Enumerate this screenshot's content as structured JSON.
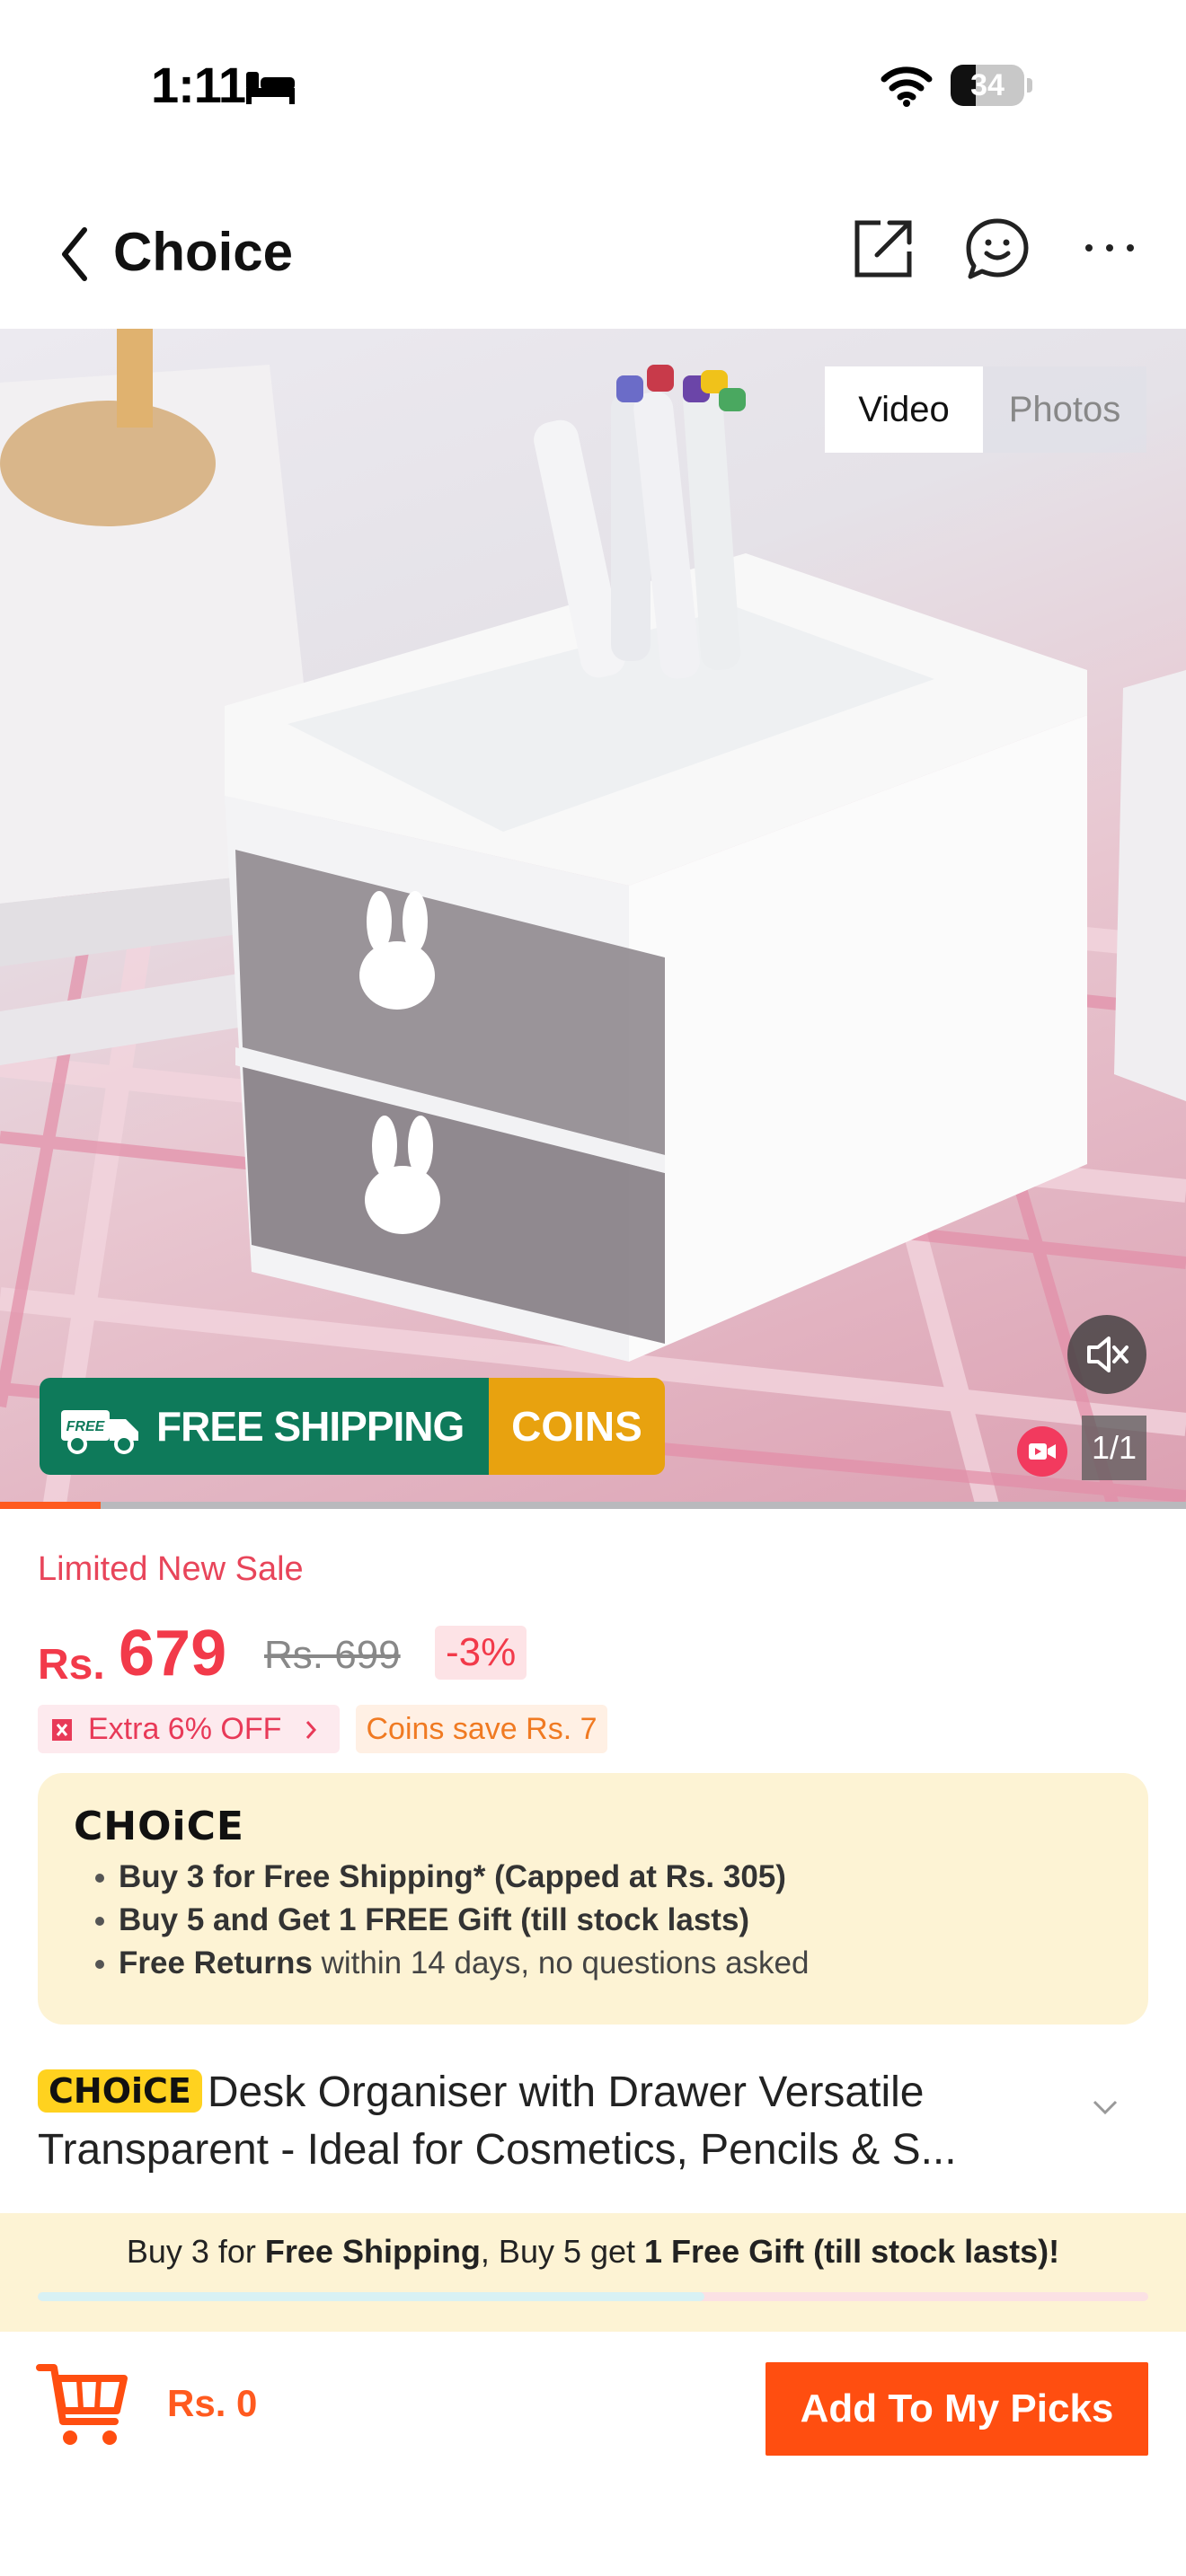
{
  "status_bar": {
    "time": "1:11",
    "battery_percent": 34,
    "battery_label": "34",
    "icons": [
      "bed-icon",
      "wifi-icon",
      "battery-icon"
    ]
  },
  "header": {
    "title": "Choice",
    "icons": [
      "back-icon",
      "share-icon",
      "chat-icon",
      "more-icon"
    ]
  },
  "media": {
    "tabs": [
      {
        "label": "Video",
        "selected": true
      },
      {
        "label": "Photos",
        "selected": false
      }
    ],
    "banner": {
      "free_tag": "FREE",
      "shipping_label": "FREE SHIPPING",
      "coins_label": "COINS"
    },
    "counter": "1/1",
    "progress_fraction": 0.085,
    "icons": [
      "mute-icon",
      "video-badge-icon",
      "truck-icon"
    ]
  },
  "price": {
    "sale_label": "Limited New Sale",
    "currency": "Rs.",
    "current": "679",
    "original": "Rs. 699",
    "discount": "-3%",
    "extra_off": "Extra 6% OFF",
    "coins_save": "Coins save Rs. 7"
  },
  "choice_box": {
    "logo": "CHOiCE",
    "benefits": [
      {
        "bold": "Buy 3 for  Free Shipping* (Capped at Rs. 305)",
        "rest": ""
      },
      {
        "bold": "Buy 5 and Get 1 FREE Gift (till stock lasts)",
        "rest": ""
      },
      {
        "bold": "Free Returns",
        "rest": " within 14 days, no questions asked"
      }
    ]
  },
  "product": {
    "tag": "CHOiCE",
    "title_line1": "Desk Organiser with Drawer Versatile",
    "title_line2": "Transparent  - Ideal for Cosmetics, Pencils & S..."
  },
  "promo": {
    "part1": "Buy 3 for ",
    "bold1": "Free Shipping",
    "part2": ", Buy 5 get ",
    "bold2": "1 Free Gift (till stock lasts)!",
    "progress_fraction": 0.6
  },
  "bottom_bar": {
    "cart_total": "Rs. 0",
    "add_button": "Add To My Picks"
  },
  "colors": {
    "accent": "#ff4e10",
    "price_red": "#f23a4a",
    "shipping_green": "#0e7a5a",
    "coins_gold": "#e8a20f",
    "choice_yellow": "#ffd21f",
    "choice_bg": "#fdf3d4"
  }
}
